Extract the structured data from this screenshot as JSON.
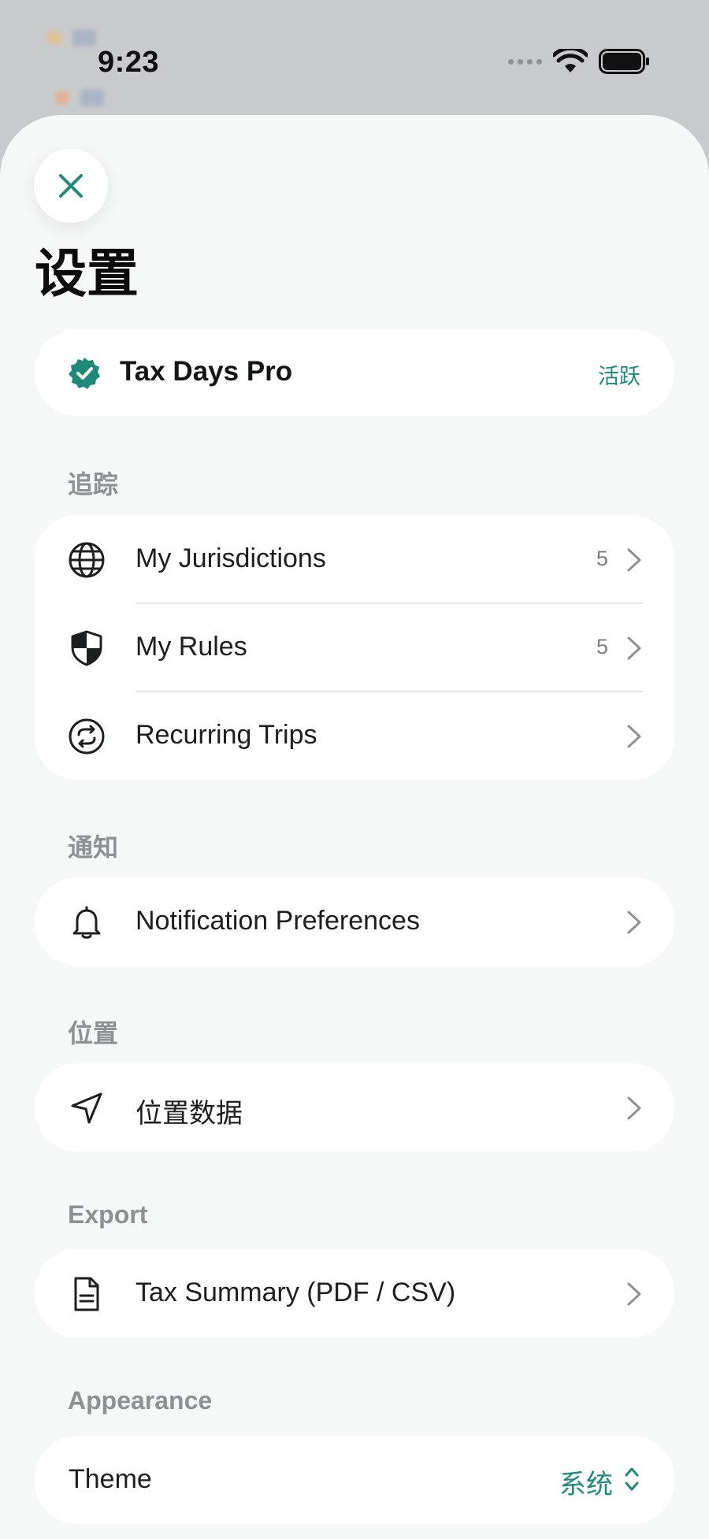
{
  "status_bar": {
    "time": "9:23"
  },
  "sheet": {
    "title": "设置",
    "close_icon": "close-icon"
  },
  "pro": {
    "name": "Tax Days Pro",
    "status": "活跃",
    "icon": "verified-badge-icon",
    "accent_color": "#1f8a77"
  },
  "sections": {
    "tracking": {
      "label": "追踪",
      "items": [
        {
          "label": "My Jurisdictions",
          "count": "5",
          "icon": "globe-icon"
        },
        {
          "label": "My Rules",
          "count": "5",
          "icon": "shield-icon"
        },
        {
          "label": "Recurring Trips",
          "count": "",
          "icon": "recurring-arrows-icon"
        }
      ]
    },
    "notifications": {
      "label": "通知",
      "items": [
        {
          "label": "Notification Preferences",
          "icon": "bell-icon"
        }
      ]
    },
    "location": {
      "label": "位置",
      "items": [
        {
          "label": "位置数据",
          "icon": "location-arrow-icon"
        }
      ]
    },
    "export": {
      "label": "Export",
      "items": [
        {
          "label": "Tax Summary (PDF / CSV)",
          "icon": "document-icon"
        }
      ]
    },
    "appearance": {
      "label": "Appearance",
      "theme_label": "Theme",
      "theme_value": "系统"
    }
  }
}
